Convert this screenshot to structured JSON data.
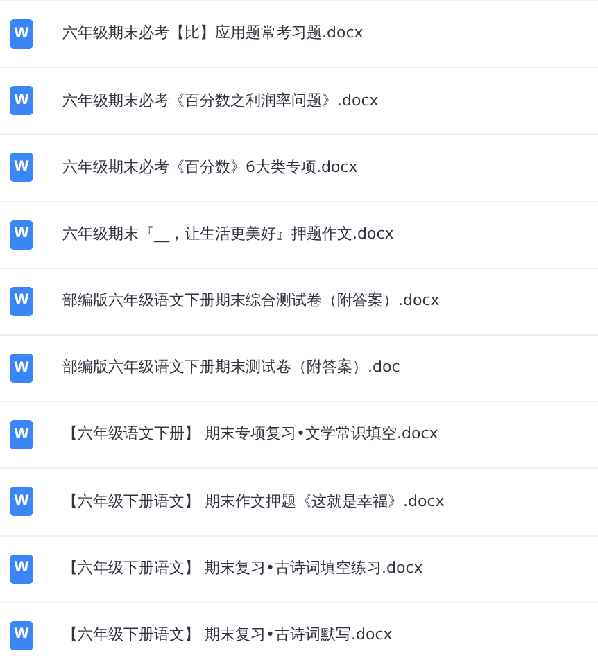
{
  "files": [
    {
      "icon_letter": "W",
      "name": "六年级期末必考【比】应用题常考习题.docx"
    },
    {
      "icon_letter": "W",
      "name": "六年级期末必考《百分数之利润率问题》.docx"
    },
    {
      "icon_letter": "W",
      "name": "六年级期末必考《百分数》6大类专项.docx"
    },
    {
      "icon_letter": "W",
      "name": "六年级期末『__，让生活更美好』押题作文.docx"
    },
    {
      "icon_letter": "W",
      "name": "部编版六年级语文下册期末综合测试卷（附答案）.docx"
    },
    {
      "icon_letter": "W",
      "name": "部编版六年级语文下册期末测试卷（附答案）.doc"
    },
    {
      "icon_letter": "W",
      "name": "【六年级语文下册】 期末专项复习•文学常识填空.docx"
    },
    {
      "icon_letter": "W",
      "name": "【六年级下册语文】 期末作文押题《这就是幸福》.docx"
    },
    {
      "icon_letter": "W",
      "name": "【六年级下册语文】 期末复习•古诗词填空练习.docx"
    },
    {
      "icon_letter": "W",
      "name": "【六年级下册语文】 期末复习•古诗词默写.docx"
    }
  ]
}
